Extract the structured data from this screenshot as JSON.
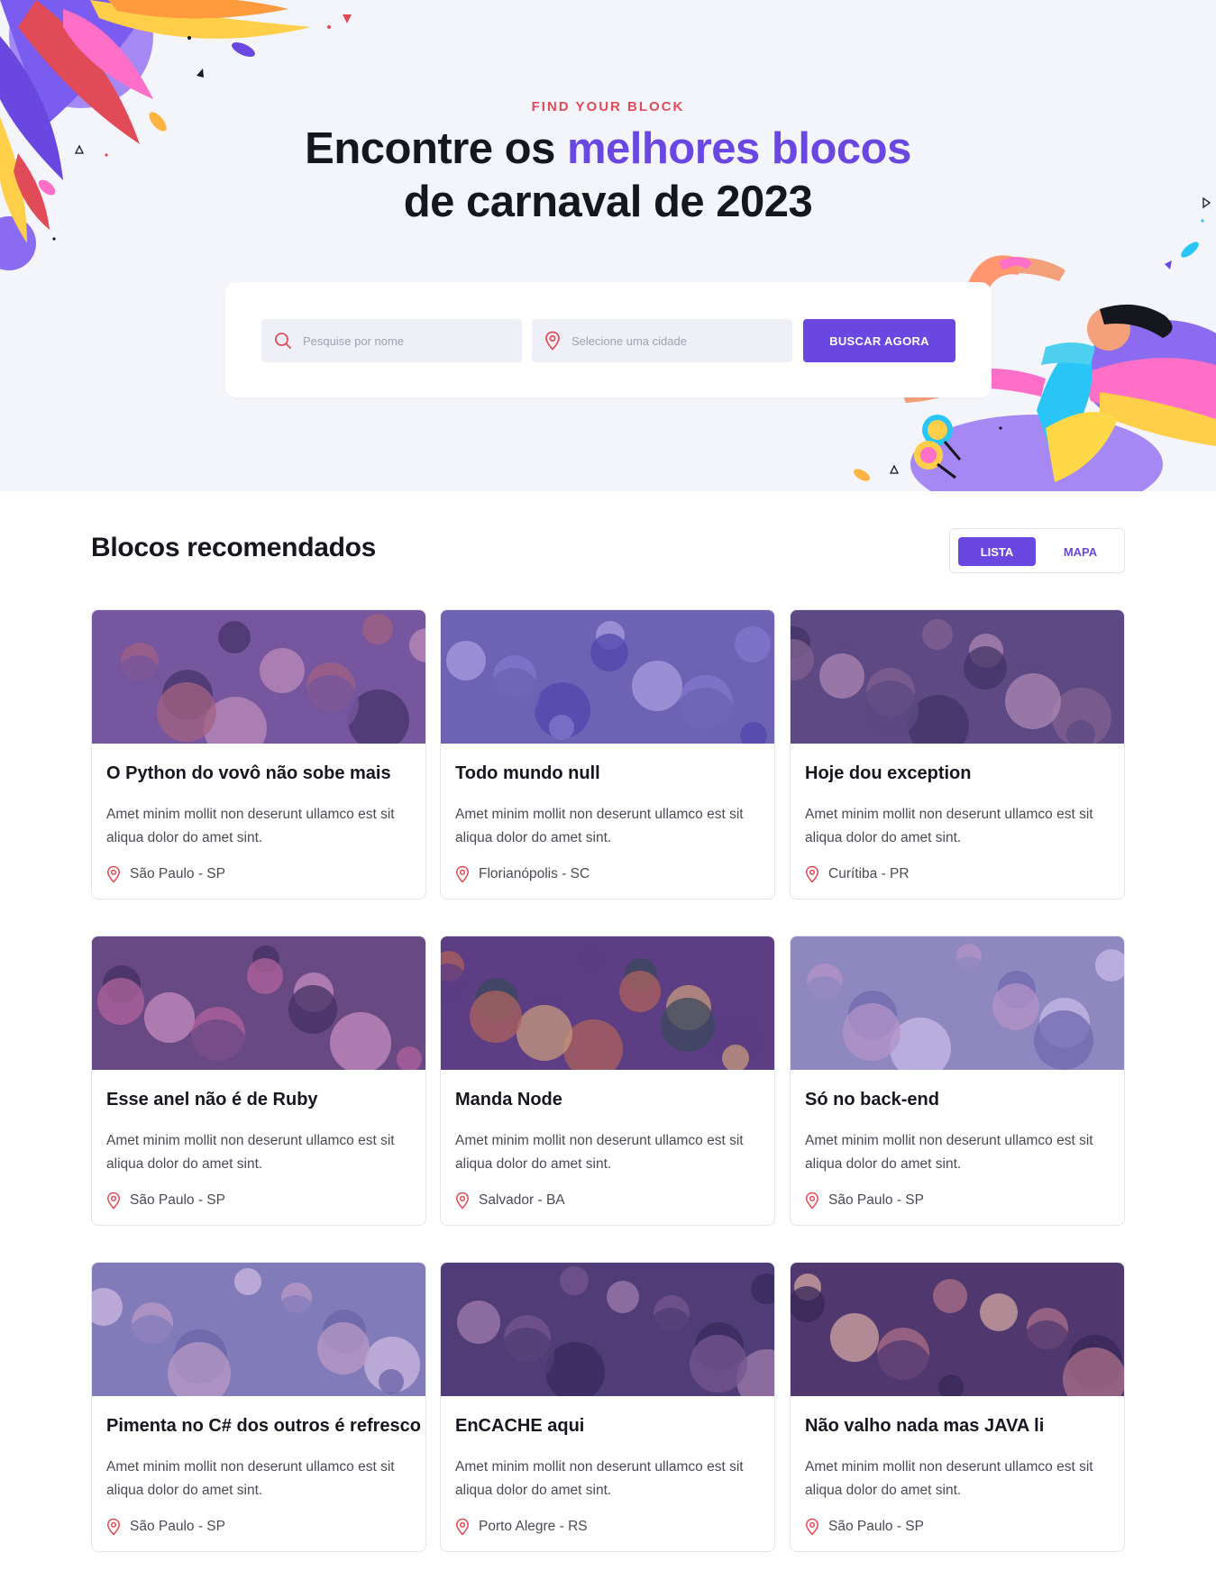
{
  "hero": {
    "eyebrow": "FIND YOUR BLOCK",
    "headline_part1": "Encontre os ",
    "headline_accent": "melhores blocos",
    "headline_part2": "de carnaval de 2023"
  },
  "search": {
    "name_placeholder": "Pesquise por nome",
    "city_placeholder": "Selecione uma cidade",
    "button_label": "BUSCAR AGORA"
  },
  "recommended": {
    "title": "Blocos recomendados",
    "view_toggle": {
      "list_label": "LISTA",
      "map_label": "MAPA",
      "active": "LISTA"
    }
  },
  "blocks": [
    {
      "title": "O Python do vovô não sobe mais",
      "description": "Amet minim mollit non deserunt ullamco est sit aliqua dolor do amet sint.",
      "location": "São Paulo - SP"
    },
    {
      "title": "Todo mundo null",
      "description": "Amet minim mollit non deserunt ullamco est sit aliqua dolor do amet sint.",
      "location": "Florianópolis - SC"
    },
    {
      "title": "Hoje dou exception",
      "description": "Amet minim mollit non deserunt ullamco est sit aliqua dolor do amet sint.",
      "location": "Curítiba - PR"
    },
    {
      "title": "Esse anel não é de Ruby",
      "description": "Amet minim mollit non deserunt ullamco est sit aliqua dolor do amet sint.",
      "location": "São Paulo - SP"
    },
    {
      "title": "Manda Node",
      "description": "Amet minim mollit non deserunt ullamco est sit aliqua dolor do amet sint.",
      "location": "Salvador - BA"
    },
    {
      "title": "Só no back-end",
      "description": "Amet minim mollit non deserunt ullamco est sit aliqua dolor do amet sint.",
      "location": "São Paulo - SP"
    },
    {
      "title": "Pimenta no C# dos outros é refresco",
      "description": "Amet minim mollit non deserunt ullamco est sit aliqua dolor do amet sint.",
      "location": "São Paulo - SP"
    },
    {
      "title": "EnCACHE aqui",
      "description": "Amet minim mollit non deserunt ullamco est sit aliqua dolor do amet sint.",
      "location": "Porto Alegre - RS"
    },
    {
      "title": "Não valho nada mas JAVA li",
      "description": "Amet minim mollit non deserunt ullamco est sit aliqua dolor do amet sint.",
      "location": "São Paulo - SP"
    }
  ],
  "colors": {
    "accent": "#6a47e0",
    "eyebrow": "#e14b57",
    "pin": "#e14b57",
    "hero_bg": "#f4f4fb"
  },
  "icons": {
    "search": "search-icon",
    "city": "map-pin-icon",
    "card_location": "map-pin-icon"
  }
}
